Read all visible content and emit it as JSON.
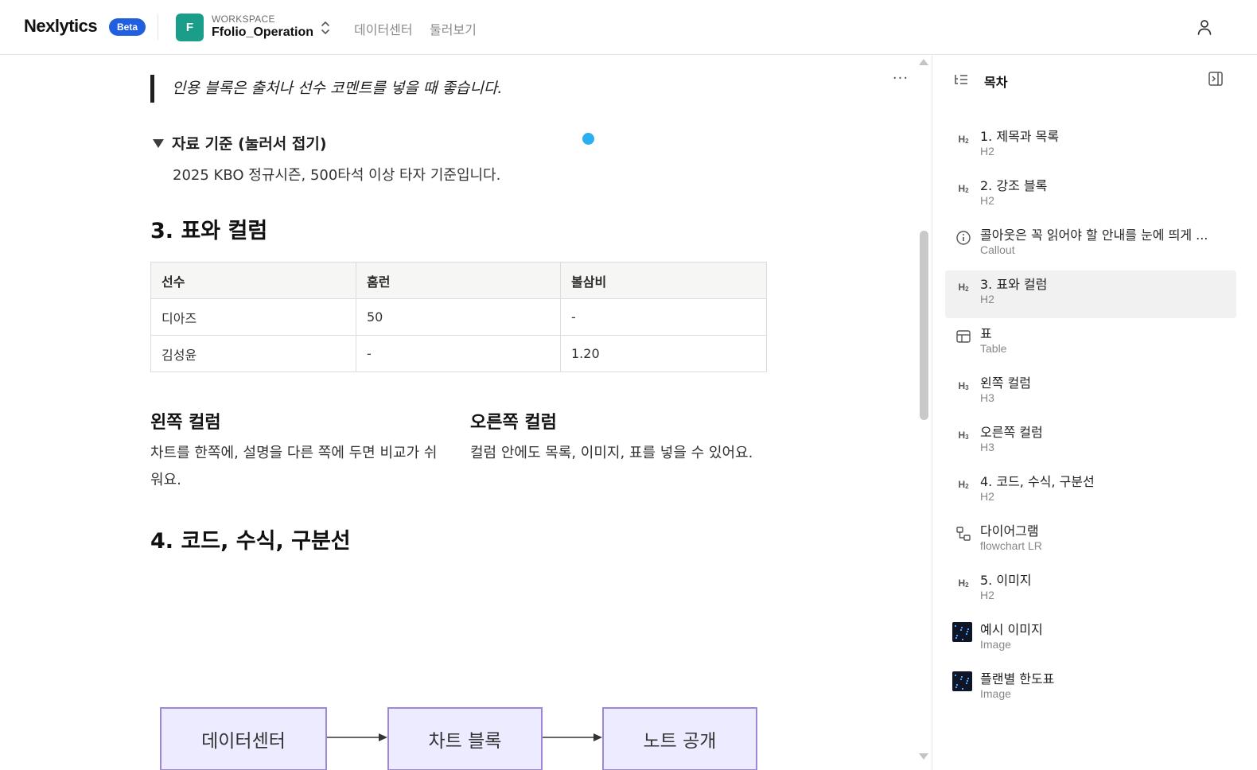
{
  "header": {
    "logo": "Nexlytics",
    "beta": "Beta",
    "workspace_initial": "F",
    "workspace_label": "WORKSPACE",
    "workspace_name": "Ffolio_Operation",
    "nav": [
      "데이터센터",
      "둘러보기"
    ]
  },
  "content": {
    "quote": "인용 블록은 출처나 선수 코멘트를 넣을 때 좋습니다.",
    "toggle_title": "자료 기준 (눌러서 접기)",
    "toggle_body": "2025 KBO 정규시즌, 500타석 이상 타자 기준입니다.",
    "section3_title": "3. 표와 컬럼",
    "table": {
      "headers": [
        "선수",
        "홈런",
        "볼삼비"
      ],
      "rows": [
        [
          "디아즈",
          "50",
          "-"
        ],
        [
          "김성윤",
          "-",
          "1.20"
        ]
      ]
    },
    "left_col": {
      "title": "왼쪽 컬럼",
      "text": "차트를 한쪽에, 설명을 다른 쪽에 두면 비교가 쉬워요."
    },
    "right_col": {
      "title": "오른쪽 컬럼",
      "text": "컬럼 안에도 목록, 이미지, 표를 넣을 수 있어요."
    },
    "section4_title": "4. 코드, 수식, 구분선",
    "diagram_nodes": [
      "데이터센터",
      "차트 블록",
      "노트 공개"
    ],
    "more": "···"
  },
  "toc": {
    "title": "목차",
    "items": [
      {
        "icon": "h2-icon",
        "label": "1. 제목과 목록",
        "sub": "H2"
      },
      {
        "icon": "h2-icon",
        "label": "2. 강조 블록",
        "sub": "H2"
      },
      {
        "icon": "info-icon",
        "label": "콜아웃은 꼭 읽어야 할 안내를 눈에 띄게 ...",
        "sub": "Callout"
      },
      {
        "icon": "h2-icon",
        "label": "3. 표와 컬럼",
        "sub": "H2"
      },
      {
        "icon": "table-icon",
        "label": "표",
        "sub": "Table"
      },
      {
        "icon": "h3-icon",
        "label": "왼쪽 컬럼",
        "sub": "H3"
      },
      {
        "icon": "h3-icon",
        "label": "오른쪽 컬럼",
        "sub": "H3"
      },
      {
        "icon": "h2-icon",
        "label": "4. 코드, 수식, 구분선",
        "sub": "H2"
      },
      {
        "icon": "diagram-icon",
        "label": "다이어그램",
        "sub": "flowchart LR"
      },
      {
        "icon": "h2-icon",
        "label": "5. 이미지",
        "sub": "H2"
      },
      {
        "icon": "image-thumbnail",
        "label": "예시 이미지",
        "sub": "Image"
      },
      {
        "icon": "image-thumbnail",
        "label": "플랜별 한도표",
        "sub": "Image"
      }
    ],
    "active_index": 3
  },
  "colors": {
    "accent": "#1f5fe0",
    "workspace": "#1a9e8a",
    "diagram_fill": "#ecebff",
    "diagram_border": "#9e86d8",
    "dot": "#2ab0f0"
  }
}
